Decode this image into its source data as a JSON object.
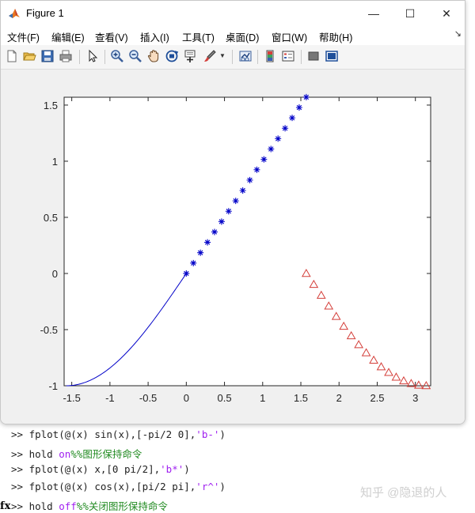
{
  "window": {
    "title": "Figure 1",
    "controls": {
      "minimize": "—",
      "maximize": "☐",
      "close": "✕"
    }
  },
  "menu": [
    "文件(F)",
    "编辑(E)",
    "查看(V)",
    "插入(I)",
    "工具(T)",
    "桌面(D)",
    "窗口(W)",
    "帮助(H)"
  ],
  "menu_overflow": "↘",
  "toolbar_icons": [
    "new-figure-icon",
    "open-file-icon",
    "save-icon",
    "print-icon",
    "pointer-icon",
    "zoom-in-icon",
    "zoom-out-icon",
    "pan-icon",
    "rotate-3d-icon",
    "data-cursor-icon",
    "brush-icon",
    "link-plot-icon",
    "colorbar-icon",
    "legend-icon",
    "hide-plot-tools-icon",
    "show-plot-tools-icon"
  ],
  "colors": {
    "series_blue": "#0000c8",
    "series_red": "#d43f3a",
    "axes_bg": "#ffffff",
    "figure_bg": "#f0f0f0"
  },
  "chart_data": {
    "type": "line",
    "xlim": [
      -1.6,
      3.2
    ],
    "ylim": [
      -1,
      1.57
    ],
    "x_ticks": [
      -1.5,
      -1,
      -0.5,
      0,
      0.5,
      1,
      1.5,
      2,
      2.5,
      3
    ],
    "x_tick_labels": [
      "-1.5",
      "-1",
      "-0.5",
      "0",
      "0.5",
      "1",
      "1.5",
      "2",
      "2.5",
      "3"
    ],
    "y_ticks": [
      -1,
      -0.5,
      0,
      0.5,
      1,
      1.5
    ],
    "y_tick_labels": [
      "-1",
      "-0.5",
      "0",
      "0.5",
      "1",
      "1.5"
    ],
    "grid": false,
    "series": [
      {
        "function": "sin(x)",
        "domain": [
          -1.5708,
          0
        ],
        "style": "b-",
        "marker": "none"
      },
      {
        "function": "x",
        "domain": [
          0,
          1.5708
        ],
        "style": "b*",
        "marker": "asterisk",
        "n_points": 18
      },
      {
        "function": "cos(x)",
        "domain": [
          1.5708,
          3.1416
        ],
        "style": "r^",
        "marker": "triangle",
        "n_points": 17
      }
    ]
  },
  "console": {
    "prompt": ">>",
    "lines": [
      [
        {
          "t": ">> fplot(@(x) sin(x),[-pi/2 0],",
          "c": ""
        },
        {
          "t": "'b-'",
          "c": "str"
        },
        {
          "t": ")",
          "c": ""
        }
      ],
      [
        {
          "t": ">> hold ",
          "c": ""
        },
        {
          "t": "on",
          "c": "kw"
        },
        {
          "t": "%%图形保持命令",
          "c": "cmt"
        }
      ],
      [
        {
          "t": ">> fplot(@(x) x,[0 pi/2],",
          "c": ""
        },
        {
          "t": "'b*'",
          "c": "str"
        },
        {
          "t": ")",
          "c": ""
        }
      ],
      [
        {
          "t": ">> fplot(@(x) cos(x),[pi/2 pi],",
          "c": ""
        },
        {
          "t": "'r^'",
          "c": "str"
        },
        {
          "t": ")",
          "c": ""
        }
      ],
      [
        {
          "t": ">> hold ",
          "c": ""
        },
        {
          "t": "off",
          "c": "kw"
        },
        {
          "t": "%%关闭图形保持命令",
          "c": "cmt"
        }
      ]
    ],
    "fx_marker": "fx"
  },
  "watermark": "知乎 @隐退的人"
}
